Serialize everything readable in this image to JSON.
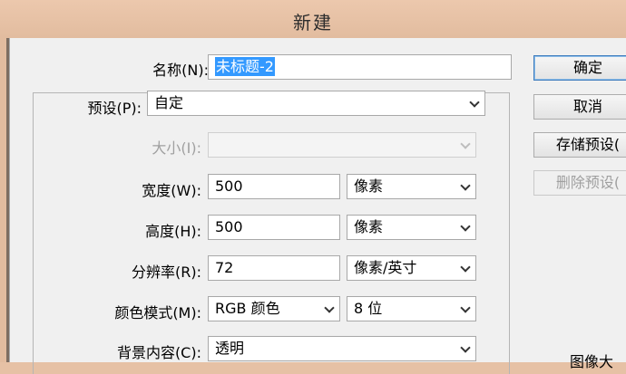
{
  "window": {
    "title": "新建"
  },
  "form": {
    "name": {
      "label": "名称(N):",
      "value": "未标题-2"
    },
    "preset": {
      "label": "预设(P):",
      "value": "自定"
    },
    "size": {
      "label": "大小(I):",
      "value": ""
    },
    "width": {
      "label": "宽度(W):",
      "value": "500",
      "unit": "像素"
    },
    "height": {
      "label": "高度(H):",
      "value": "500",
      "unit": "像素"
    },
    "resolution": {
      "label": "分辨率(R):",
      "value": "72",
      "unit": "像素/英寸"
    },
    "color_mode": {
      "label": "颜色模式(M):",
      "value": "RGB 颜色",
      "depth": "8 位"
    },
    "background": {
      "label": "背景内容(C):",
      "value": "透明"
    }
  },
  "buttons": {
    "ok": "确定",
    "cancel": "取消",
    "save_preset": "存储预设(",
    "delete_preset": "删除预设("
  },
  "side": {
    "image_size_label": "图像大"
  }
}
